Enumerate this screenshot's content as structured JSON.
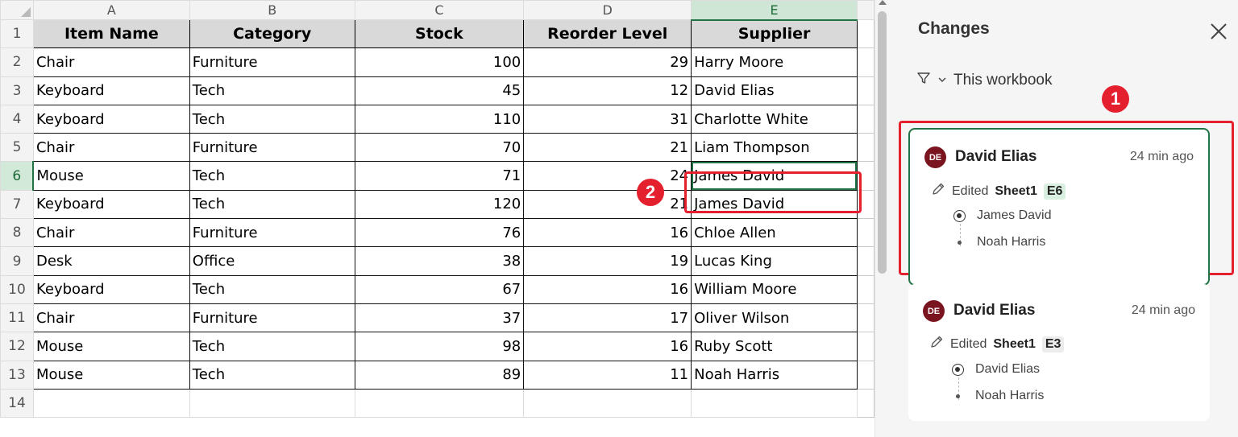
{
  "columns": [
    "A",
    "B",
    "C",
    "D",
    "E"
  ],
  "headers": [
    "Item Name",
    "Category",
    "Stock",
    "Reorder Level",
    "Supplier"
  ],
  "rows": [
    [
      "1",
      "",
      "",
      "",
      "",
      ""
    ],
    [
      "2",
      "Chair",
      "Furniture",
      "100",
      "29",
      "Harry Moore"
    ],
    [
      "3",
      "Keyboard",
      "Tech",
      "45",
      "12",
      "David Elias"
    ],
    [
      "4",
      "Keyboard",
      "Tech",
      "110",
      "31",
      "Charlotte White"
    ],
    [
      "5",
      "Chair",
      "Furniture",
      "70",
      "21",
      "Liam Thompson"
    ],
    [
      "6",
      "Mouse",
      "Tech",
      "71",
      "24",
      "James David"
    ],
    [
      "7",
      "Keyboard",
      "Tech",
      "120",
      "21",
      "James David"
    ],
    [
      "8",
      "Chair",
      "Furniture",
      "76",
      "16",
      "Chloe Allen"
    ],
    [
      "9",
      "Desk",
      "Office",
      "38",
      "19",
      "Lucas King"
    ],
    [
      "10",
      "Keyboard",
      "Tech",
      "67",
      "16",
      "William Moore"
    ],
    [
      "11",
      "Chair",
      "Furniture",
      "37",
      "17",
      "Oliver Wilson"
    ],
    [
      "12",
      "Mouse",
      "Tech",
      "98",
      "16",
      "Ruby Scott"
    ],
    [
      "13",
      "Mouse",
      "Tech",
      "89",
      "11",
      "Noah Harris"
    ],
    [
      "14",
      "",
      "",
      "",
      "",
      ""
    ]
  ],
  "selection": {
    "cell": "E6",
    "column": "E",
    "row": "6"
  },
  "panel": {
    "title": "Changes",
    "filter_label": "This workbook",
    "cards": [
      {
        "initials": "DE",
        "author": "David Elias",
        "time": "24 min ago",
        "action": "Edited",
        "sheet": "Sheet1",
        "cell": "E6",
        "new_value": "James David",
        "old_value": "Noah Harris",
        "ref_color": "#d9efe0"
      },
      {
        "initials": "DE",
        "author": "David Elias",
        "time": "24 min ago",
        "action": "Edited",
        "sheet": "Sheet1",
        "cell": "E3",
        "new_value": "David Elias",
        "old_value": "Noah Harris",
        "ref_color": "#ececec"
      }
    ]
  },
  "callouts": [
    "1",
    "2"
  ],
  "colors": {
    "accent_green": "#217346",
    "highlight_red": "#e5202e",
    "avatar": "#7a1520"
  },
  "icons": [
    "select-all-icon",
    "filter-icon",
    "chevron-down-icon",
    "close-icon",
    "pencil-icon",
    "radio-icon",
    "dot-icon"
  ]
}
